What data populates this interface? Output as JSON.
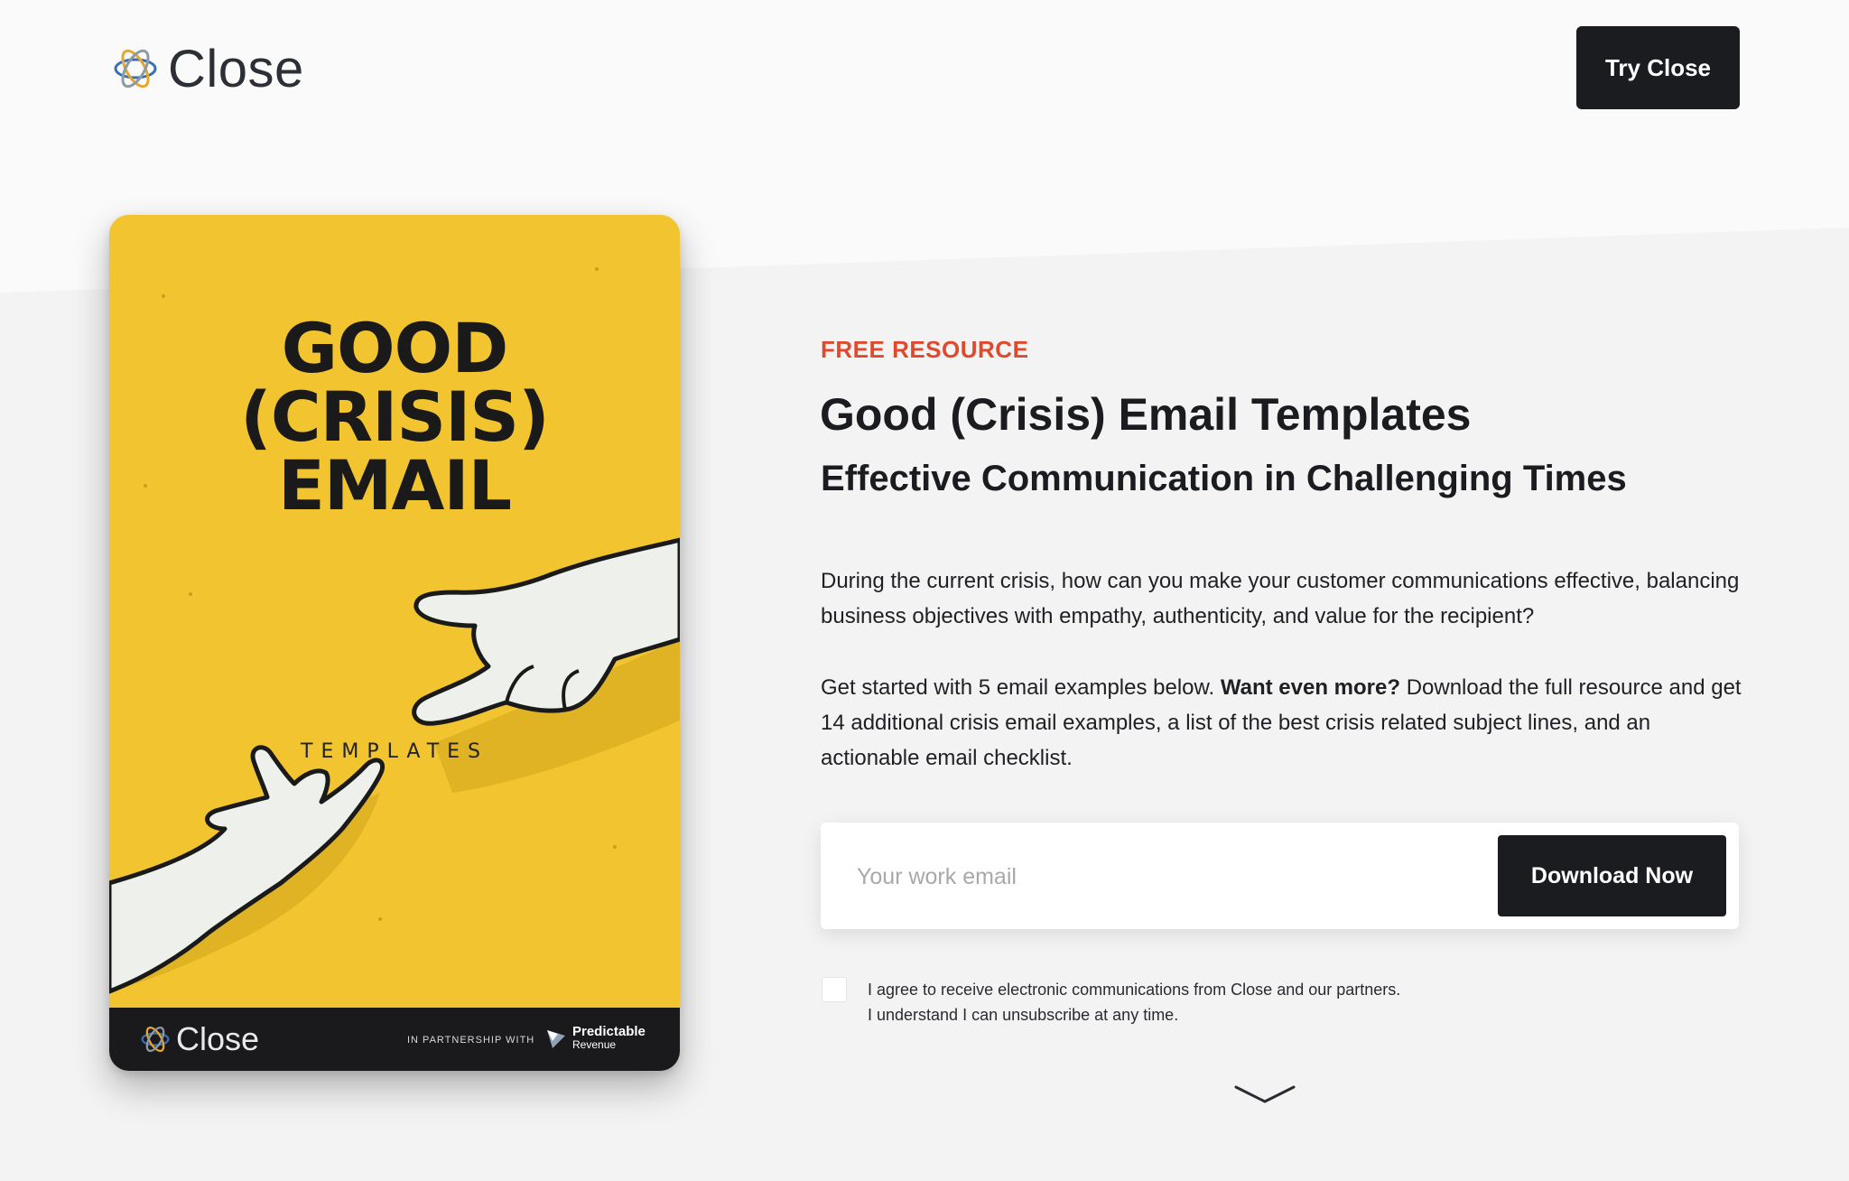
{
  "header": {
    "logo_text": "Close",
    "try_button": "Try Close"
  },
  "cover": {
    "title_lines": [
      "GOOD",
      "(CRISIS)",
      "EMAIL"
    ],
    "subtitle": "TEMPLATES",
    "footer_logo": "Close",
    "partner_text": "IN PARTNERSHIP WITH",
    "partner_name": "Predictable",
    "partner_name_2": "Revenue",
    "bg_color": "#f2c530"
  },
  "main": {
    "eyebrow": "FREE RESOURCE",
    "title": "Good (Crisis) Email Templates",
    "subtitle": "Effective Communication in Challenging Times",
    "paragraph1": "During the current crisis, how can you make your customer communications effective, balancing business objectives with empathy, authenticity, and value for the recipient?",
    "paragraph2_start": "Get started with 5 email examples below. ",
    "paragraph2_bold": "Want even more?",
    "paragraph2_end": " Download the full resource and get 14 additional crisis email examples, a list of the best crisis related subject lines, and an actionable email checklist."
  },
  "form": {
    "email_placeholder": "Your work email",
    "email_value": "",
    "download_button": "Download Now",
    "consent_line1": "I agree to receive electronic communications from Close and our partners.",
    "consent_line2": "I understand I can unsubscribe at any time.",
    "consent_checked": false
  },
  "icons": {
    "logo": "close-logo-icon",
    "scroll": "chevron-down-icon"
  },
  "colors": {
    "accent": "#e04a2c",
    "button": "#1b1c20",
    "cover": "#f2c530"
  }
}
